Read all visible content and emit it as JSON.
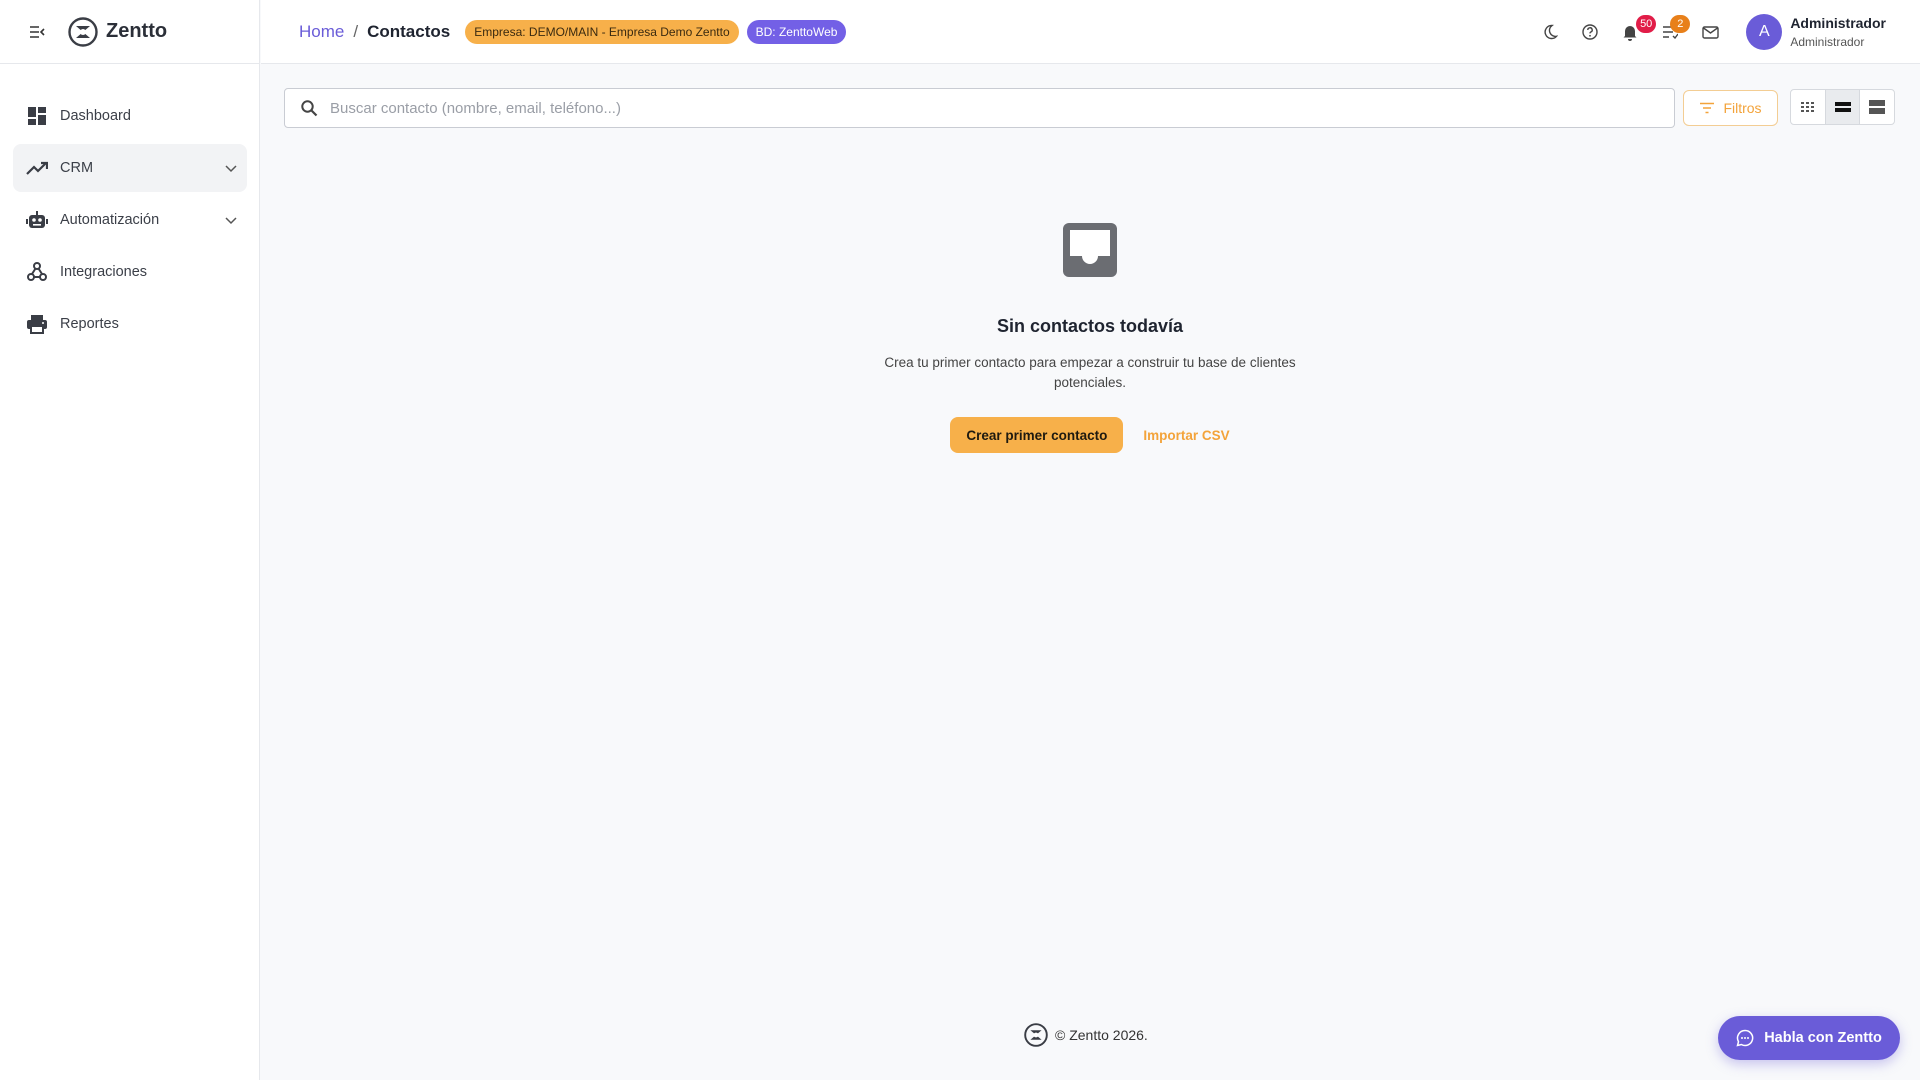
{
  "app": {
    "name": "Zentto"
  },
  "sidebar": {
    "items": [
      {
        "label": "Dashboard",
        "icon": "dashboard-icon"
      },
      {
        "label": "CRM",
        "icon": "trending-up-icon",
        "expandable": true,
        "active": true
      },
      {
        "label": "Automatización",
        "icon": "robot-icon",
        "expandable": true
      },
      {
        "label": "Integraciones",
        "icon": "webhook-icon"
      },
      {
        "label": "Reportes",
        "icon": "printer-icon"
      }
    ]
  },
  "header": {
    "breadcrumb": {
      "home": "Home",
      "separator": "/",
      "current": "Contactos"
    },
    "company_badge": "Empresa: DEMO/MAIN - Empresa Demo Zentto",
    "db_badge": "BD: ZenttoWeb",
    "notifications_count": "50",
    "tasks_count": "2",
    "user": {
      "initial": "A",
      "name": "Administrador",
      "role": "Administrador"
    }
  },
  "toolbar": {
    "search_placeholder": "Buscar contacto (nombre, email, teléfono...)",
    "search_value": "",
    "filter_label": "Filtros",
    "view_modes": [
      "compact",
      "standard",
      "comfortable"
    ],
    "active_view": "standard"
  },
  "empty_state": {
    "title": "Sin contactos todavía",
    "description": "Crea tu primer contacto para empezar a construir tu base de clientes potenciales.",
    "primary_action": "Crear primer contacto",
    "secondary_action": "Importar CSV"
  },
  "footer": {
    "text": "© Zentto 2026."
  },
  "chat_button": {
    "label": "Habla con Zentto"
  },
  "colors": {
    "accent": "#6a5cd8",
    "primary_action": "#f7b04a",
    "badge_red": "#e11d48",
    "badge_orange": "#e8801a"
  }
}
